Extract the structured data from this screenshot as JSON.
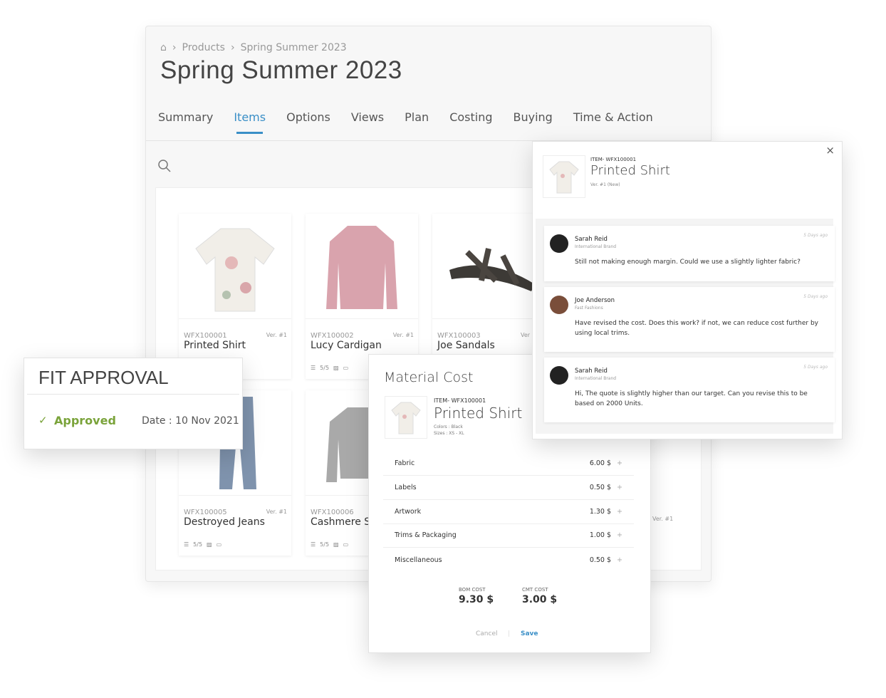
{
  "breadcrumb": {
    "home_icon": "home-icon",
    "items": [
      "Products",
      "Spring Summer 2023"
    ]
  },
  "page_title": "Spring Summer 2023",
  "tabs": [
    "Summary",
    "Items",
    "Options",
    "Views",
    "Plan",
    "Costing",
    "Buying",
    "Time & Action"
  ],
  "active_tab": "Items",
  "accent": "#3a8fc7",
  "items": [
    {
      "code": "WFX100001",
      "name": "Printed Shirt",
      "ver": "Ver. #1"
    },
    {
      "code": "WFX100002",
      "name": "Lucy Cardigan",
      "ver": "Ver. #1",
      "progress": "5/5"
    },
    {
      "code": "WFX100003",
      "name": "Joe Sandals",
      "ver": "Ver"
    },
    {
      "code": "WFX100005",
      "name": "Destroyed Jeans",
      "ver": "Ver. #1",
      "progress": "5/5"
    },
    {
      "code": "WFX100006",
      "name": "Cashmere Sw",
      "ver": "",
      "progress": "5/5"
    }
  ],
  "hidden_ver": "Ver. #1",
  "fit_approval": {
    "title": "FIT APPROVAL",
    "status": "Approved",
    "date": "Date : 10 Nov 2021",
    "status_color": "#7aa33a"
  },
  "material_cost": {
    "title": "Material Cost",
    "item_code": "ITEM- WFX100001",
    "item_name": "Printed Shirt",
    "colors": "Colors : Black",
    "sizes": "Sizes : XS - XL",
    "rows": [
      {
        "label": "Fabric",
        "value": "6.00 $"
      },
      {
        "label": "Labels",
        "value": "0.50 $"
      },
      {
        "label": "Artwork",
        "value": "1.30 $"
      },
      {
        "label": "Trims & Packaging",
        "value": "1.00 $"
      },
      {
        "label": "Miscellaneous",
        "value": "0.50 $"
      }
    ],
    "bom_label": "BOM COST",
    "bom_value": "9.30 $",
    "cmt_label": "CMT COST",
    "cmt_value": "3.00 $",
    "cancel": "Cancel",
    "save": "Save"
  },
  "comments_panel": {
    "item_code": "ITEM- WFX100001",
    "item_name": "Printed Shirt",
    "version": "Ver. #1 (New)",
    "comments": [
      {
        "name": "Sarah Reid",
        "org": "International Brand",
        "time": "5 Days ago",
        "text": "Still not making enough margin. Could we use a slightly lighter fabric?"
      },
      {
        "name": "Joe Anderson",
        "org": "Fast Fashions",
        "time": "5 Days ago",
        "text": "Have revised the cost. Does this work? if not, we can reduce cost further by using local trims."
      },
      {
        "name": "Sarah Reid",
        "org": "International Brand",
        "time": "5 Days ago",
        "text": "Hi, The quote is slightly higher than our target. Can you revise this to be based on 2000 Units."
      }
    ]
  }
}
